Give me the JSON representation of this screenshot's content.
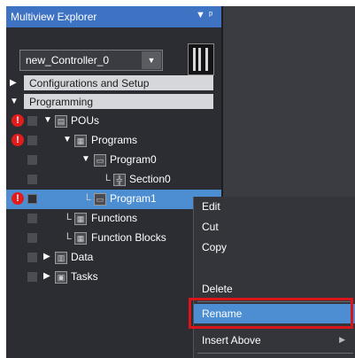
{
  "panel": {
    "title": "Multiview Explorer",
    "pin_icon": "pin-icon",
    "menu_icon": "dropdown-menu-icon"
  },
  "controller_selector": {
    "value": "new_Controller_0",
    "arrow_icon": "chevron-down-icon"
  },
  "controller_icon": "controller-device-icon",
  "categories": {
    "config": "Configurations and Setup",
    "programming": "Programming"
  },
  "tree": {
    "pous": "POUs",
    "programs": "Programs",
    "program0": "Program0",
    "section0": "Section0",
    "program1": "Program1",
    "functions": "Functions",
    "function_blocks": "Function Blocks",
    "data": "Data",
    "tasks": "Tasks"
  },
  "error_mark": "!",
  "context_menu": {
    "edit": "Edit",
    "cut": "Cut",
    "copy": "Copy",
    "delete": "Delete",
    "rename": "Rename",
    "insert_above": "Insert Above"
  },
  "colors": {
    "title_bar": "#3e73c4",
    "selection": "#4d8ed2",
    "error": "#e21b1b",
    "highlight_frame": "#d8151b"
  }
}
